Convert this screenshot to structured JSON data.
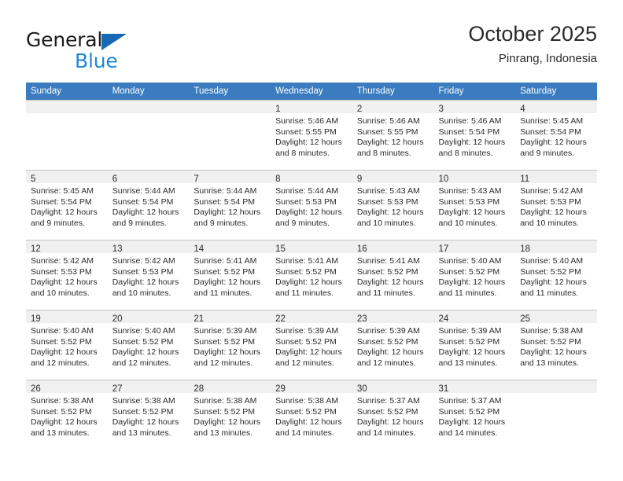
{
  "brand": {
    "name_part1": "General",
    "name_part2": "Blue",
    "logo_icon": "triangle-logo-icon"
  },
  "header": {
    "title": "October 2025",
    "subtitle": "Pinrang, Indonesia"
  },
  "colors": {
    "header_row": "#3a7cbf",
    "brand_dark": "#1b1b1b",
    "brand_blue": "#1f87d6",
    "logo_blue": "#1669b5",
    "daynum_band": "#f0f0f0",
    "grid_line": "#c3c3c3",
    "text": "#2b2b2b"
  },
  "weekday_headers": [
    "Sunday",
    "Monday",
    "Tuesday",
    "Wednesday",
    "Thursday",
    "Friday",
    "Saturday"
  ],
  "labels": {
    "sunrise_prefix": "Sunrise:",
    "sunset_prefix": "Sunset:",
    "daylight_prefix": "Daylight:"
  },
  "weeks": [
    [
      {
        "day": "",
        "lines": []
      },
      {
        "day": "",
        "lines": []
      },
      {
        "day": "",
        "lines": []
      },
      {
        "day": "1",
        "lines": [
          "Sunrise: 5:46 AM",
          "Sunset: 5:55 PM",
          "Daylight: 12 hours and 8 minutes."
        ]
      },
      {
        "day": "2",
        "lines": [
          "Sunrise: 5:46 AM",
          "Sunset: 5:55 PM",
          "Daylight: 12 hours and 8 minutes."
        ]
      },
      {
        "day": "3",
        "lines": [
          "Sunrise: 5:46 AM",
          "Sunset: 5:54 PM",
          "Daylight: 12 hours and 8 minutes."
        ]
      },
      {
        "day": "4",
        "lines": [
          "Sunrise: 5:45 AM",
          "Sunset: 5:54 PM",
          "Daylight: 12 hours and 9 minutes."
        ]
      }
    ],
    [
      {
        "day": "5",
        "lines": [
          "Sunrise: 5:45 AM",
          "Sunset: 5:54 PM",
          "Daylight: 12 hours and 9 minutes."
        ]
      },
      {
        "day": "6",
        "lines": [
          "Sunrise: 5:44 AM",
          "Sunset: 5:54 PM",
          "Daylight: 12 hours and 9 minutes."
        ]
      },
      {
        "day": "7",
        "lines": [
          "Sunrise: 5:44 AM",
          "Sunset: 5:54 PM",
          "Daylight: 12 hours and 9 minutes."
        ]
      },
      {
        "day": "8",
        "lines": [
          "Sunrise: 5:44 AM",
          "Sunset: 5:53 PM",
          "Daylight: 12 hours and 9 minutes."
        ]
      },
      {
        "day": "9",
        "lines": [
          "Sunrise: 5:43 AM",
          "Sunset: 5:53 PM",
          "Daylight: 12 hours and 10 minutes."
        ]
      },
      {
        "day": "10",
        "lines": [
          "Sunrise: 5:43 AM",
          "Sunset: 5:53 PM",
          "Daylight: 12 hours and 10 minutes."
        ]
      },
      {
        "day": "11",
        "lines": [
          "Sunrise: 5:42 AM",
          "Sunset: 5:53 PM",
          "Daylight: 12 hours and 10 minutes."
        ]
      }
    ],
    [
      {
        "day": "12",
        "lines": [
          "Sunrise: 5:42 AM",
          "Sunset: 5:53 PM",
          "Daylight: 12 hours and 10 minutes."
        ]
      },
      {
        "day": "13",
        "lines": [
          "Sunrise: 5:42 AM",
          "Sunset: 5:53 PM",
          "Daylight: 12 hours and 10 minutes."
        ]
      },
      {
        "day": "14",
        "lines": [
          "Sunrise: 5:41 AM",
          "Sunset: 5:52 PM",
          "Daylight: 12 hours and 11 minutes."
        ]
      },
      {
        "day": "15",
        "lines": [
          "Sunrise: 5:41 AM",
          "Sunset: 5:52 PM",
          "Daylight: 12 hours and 11 minutes."
        ]
      },
      {
        "day": "16",
        "lines": [
          "Sunrise: 5:41 AM",
          "Sunset: 5:52 PM",
          "Daylight: 12 hours and 11 minutes."
        ]
      },
      {
        "day": "17",
        "lines": [
          "Sunrise: 5:40 AM",
          "Sunset: 5:52 PM",
          "Daylight: 12 hours and 11 minutes."
        ]
      },
      {
        "day": "18",
        "lines": [
          "Sunrise: 5:40 AM",
          "Sunset: 5:52 PM",
          "Daylight: 12 hours and 11 minutes."
        ]
      }
    ],
    [
      {
        "day": "19",
        "lines": [
          "Sunrise: 5:40 AM",
          "Sunset: 5:52 PM",
          "Daylight: 12 hours and 12 minutes."
        ]
      },
      {
        "day": "20",
        "lines": [
          "Sunrise: 5:40 AM",
          "Sunset: 5:52 PM",
          "Daylight: 12 hours and 12 minutes."
        ]
      },
      {
        "day": "21",
        "lines": [
          "Sunrise: 5:39 AM",
          "Sunset: 5:52 PM",
          "Daylight: 12 hours and 12 minutes."
        ]
      },
      {
        "day": "22",
        "lines": [
          "Sunrise: 5:39 AM",
          "Sunset: 5:52 PM",
          "Daylight: 12 hours and 12 minutes."
        ]
      },
      {
        "day": "23",
        "lines": [
          "Sunrise: 5:39 AM",
          "Sunset: 5:52 PM",
          "Daylight: 12 hours and 12 minutes."
        ]
      },
      {
        "day": "24",
        "lines": [
          "Sunrise: 5:39 AM",
          "Sunset: 5:52 PM",
          "Daylight: 12 hours and 13 minutes."
        ]
      },
      {
        "day": "25",
        "lines": [
          "Sunrise: 5:38 AM",
          "Sunset: 5:52 PM",
          "Daylight: 12 hours and 13 minutes."
        ]
      }
    ],
    [
      {
        "day": "26",
        "lines": [
          "Sunrise: 5:38 AM",
          "Sunset: 5:52 PM",
          "Daylight: 12 hours and 13 minutes."
        ]
      },
      {
        "day": "27",
        "lines": [
          "Sunrise: 5:38 AM",
          "Sunset: 5:52 PM",
          "Daylight: 12 hours and 13 minutes."
        ]
      },
      {
        "day": "28",
        "lines": [
          "Sunrise: 5:38 AM",
          "Sunset: 5:52 PM",
          "Daylight: 12 hours and 13 minutes."
        ]
      },
      {
        "day": "29",
        "lines": [
          "Sunrise: 5:38 AM",
          "Sunset: 5:52 PM",
          "Daylight: 12 hours and 14 minutes."
        ]
      },
      {
        "day": "30",
        "lines": [
          "Sunrise: 5:37 AM",
          "Sunset: 5:52 PM",
          "Daylight: 12 hours and 14 minutes."
        ]
      },
      {
        "day": "31",
        "lines": [
          "Sunrise: 5:37 AM",
          "Sunset: 5:52 PM",
          "Daylight: 12 hours and 14 minutes."
        ]
      },
      {
        "day": "",
        "lines": []
      }
    ]
  ]
}
